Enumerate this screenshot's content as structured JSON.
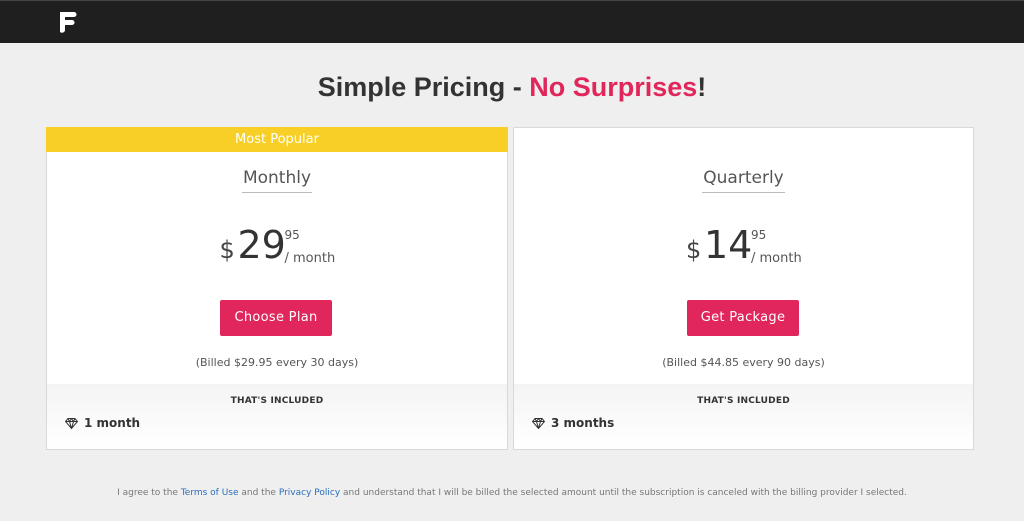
{
  "header": {
    "logo_icon": "f-logo-icon"
  },
  "headline": {
    "part1": "Simple Pricing - ",
    "accent": "No Surprises",
    "part2": "!",
    "accent_color": "#e0265a"
  },
  "plans": [
    {
      "badge": "Most Popular",
      "name": "Monthly",
      "currency": "$",
      "amount": "29",
      "cents": "95",
      "period": "/ month",
      "button": "Choose Plan",
      "billed": "(Billed $29.95 every 30 days)",
      "included_title": "THAT'S INCLUDED",
      "included_item": "1 month",
      "included_icon": "diamond-icon"
    },
    {
      "name": "Quarterly",
      "currency": "$",
      "amount": "14",
      "cents": "95",
      "period": "/ month",
      "button": "Get Package",
      "billed": "(Billed $44.85 every 90 days)",
      "included_title": "THAT'S INCLUDED",
      "included_item": "3 months",
      "included_icon": "diamond-icon"
    }
  ],
  "footer": {
    "text1": "I agree to the ",
    "terms": "Terms of Use",
    "text2": " and the ",
    "privacy": "Privacy Policy",
    "text3": " and understand that I will be billed the selected amount until the subscription is canceled with the billing provider I selected."
  },
  "colors": {
    "topbar": "#1f1f1f",
    "accent": "#e0265a",
    "badge": "#f7cf26",
    "link": "#2a6ebb"
  }
}
